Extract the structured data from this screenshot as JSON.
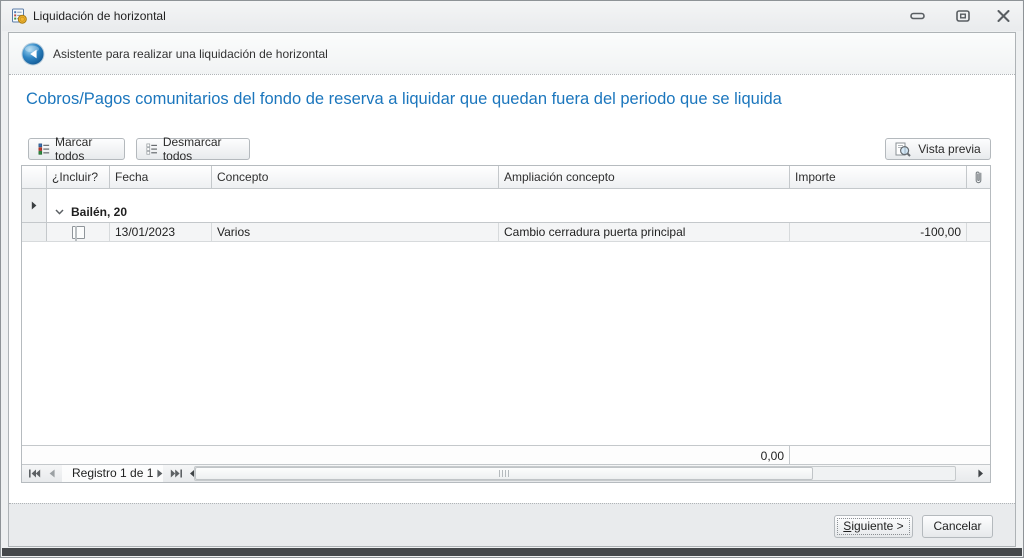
{
  "window": {
    "title": "Liquidación de horizontal"
  },
  "wizard": {
    "header": "Asistente para realizar una liquidación de horizontal",
    "heading": "Cobros/Pagos comunitarios del fondo de reserva a liquidar que quedan fuera del periodo que se liquida"
  },
  "toolbar": {
    "mark_all": "Marcar todos",
    "unmark_all": "Desmarcar todos",
    "preview": "Vista previa"
  },
  "grid": {
    "columns": [
      "¿Incluir?",
      "Fecha",
      "Concepto",
      "Ampliación concepto",
      "Importe"
    ],
    "group_label": "Bailén, 20",
    "rows": [
      {
        "incluir": false,
        "fecha": "13/01/2023",
        "concepto": "Varios",
        "ampliacion": "Cambio cerradura puerta principal",
        "importe": "-100,00"
      }
    ],
    "footer_total": "0,00",
    "pager_label": "Registro 1 de 1"
  },
  "buttons": {
    "next_underlined": "S",
    "next_rest": "iguiente >",
    "cancel": "Cancelar"
  },
  "colors": {
    "heading_blue": "#1b76bd",
    "back_button_blue": "#1565a8"
  }
}
